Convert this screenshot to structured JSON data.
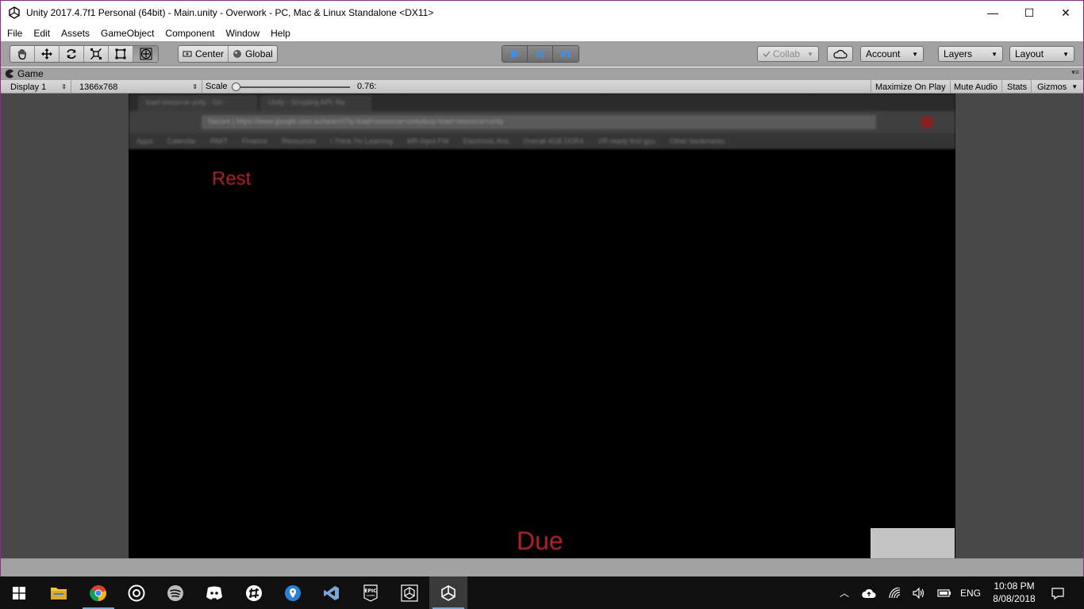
{
  "window": {
    "title": "Unity 2017.4.7f1 Personal (64bit) - Main.unity - Overwork - PC, Mac & Linux Standalone <DX11>",
    "minimize": "—",
    "maximize": "☐",
    "close": "✕"
  },
  "menu": [
    "File",
    "Edit",
    "Assets",
    "GameObject",
    "Component",
    "Window",
    "Help"
  ],
  "toolbar": {
    "pivot": "Center",
    "space": "Global",
    "collab": "Collab",
    "account": "Account",
    "layers": "Layers",
    "layout": "Layout"
  },
  "game_tab": {
    "label": "Game"
  },
  "game_bar": {
    "display": "Display 1",
    "resolution": "1366x768",
    "scale_label": "Scale",
    "scale_value": "0.76:",
    "maximize": "Maximize On Play",
    "mute": "Mute Audio",
    "stats": "Stats",
    "gizmos": "Gizmos"
  },
  "game": {
    "rest_label": "Rest",
    "due_label": "Due",
    "browser_tabs": [
      "load resource unity - Go",
      "Unity - Scripting API: Re"
    ],
    "browser_url": "Secure | https://www.google.com.au/search?q=load+resource+unity&oq=load+resource+unity",
    "bookmarks": [
      "Apps",
      "Calendar",
      "RMIT",
      "Finance",
      "Resources",
      "I Think I'm Learning",
      "MR Input FW",
      "Electronic Arts",
      "Overall 4GB DDR4",
      "VR-ready find gpu",
      "Other bookmarks"
    ]
  },
  "taskbar": {
    "language": "ENG",
    "time": "10:08 PM",
    "date": "8/08/2018"
  },
  "colors": {
    "editor_grey": "#a2a2a2",
    "game_text_red": "#b3262b",
    "play_blue": "#3d8fe8"
  }
}
